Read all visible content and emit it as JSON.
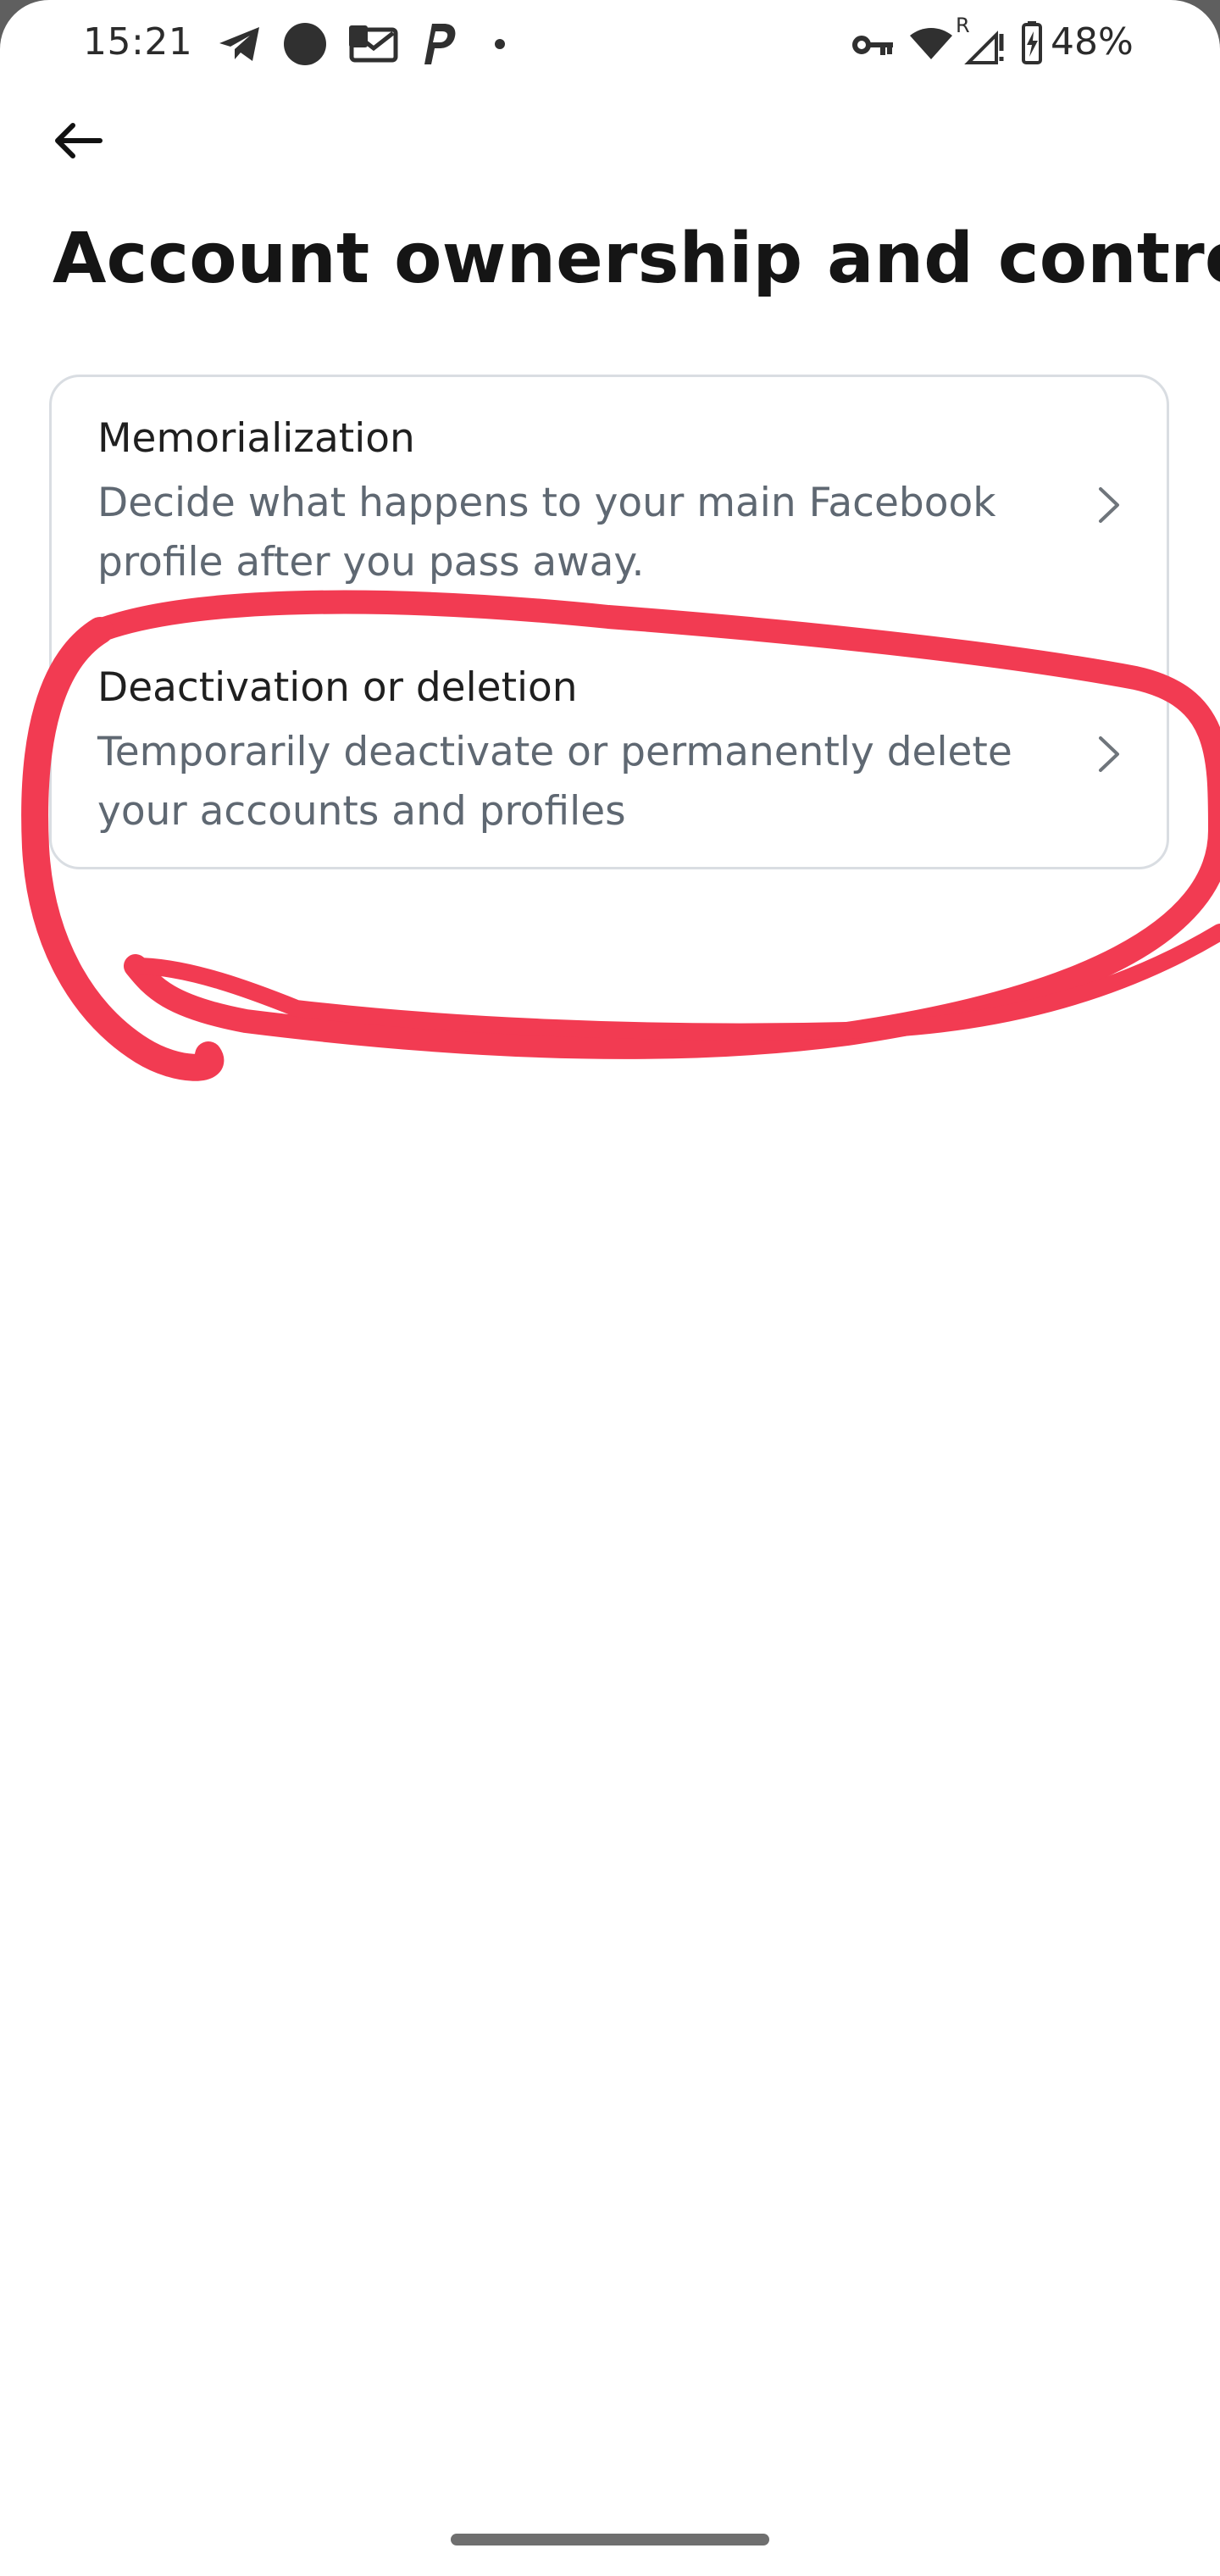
{
  "status_bar": {
    "time": "15:21",
    "battery_percent": "48%",
    "icons": [
      "telegram-icon",
      "circle-icon",
      "mail-icon",
      "paypal-icon",
      "dot-icon",
      "vpn-key-icon",
      "wifi-icon",
      "roaming-signal-icon",
      "battery-charging-icon"
    ],
    "roaming_label": "R"
  },
  "navigation": {
    "back_icon": "arrow-left-icon"
  },
  "page": {
    "title": "Account ownership and control"
  },
  "settings": {
    "items": [
      {
        "title": "Memorialization",
        "description": "Decide what happens to your main Facebook profile after you pass away.",
        "chevron_icon": "chevron-right-icon"
      },
      {
        "title": "Deactivation or deletion",
        "description": "Temporarily deactivate or permanently delete your accounts and profiles",
        "chevron_icon": "chevron-right-icon"
      }
    ]
  },
  "annotation": {
    "color": "#f23b52"
  }
}
